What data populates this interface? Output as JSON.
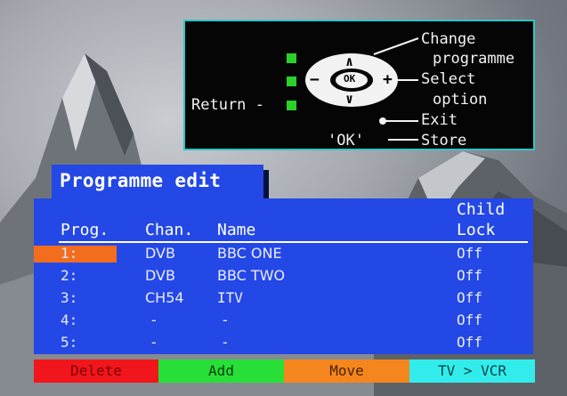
{
  "keypanel": {
    "change_line1": "Change",
    "change_line2": "programme",
    "select_line1": "Select",
    "select_line2": "option",
    "exit_label": "Exit",
    "return_label": "Return -",
    "ok_key": "OK",
    "ok_quote": "'OK'",
    "store_label": "Store",
    "up_symbol": "∧",
    "down_symbol": "∨",
    "minus_symbol": "−",
    "plus_symbol": "+",
    "accent_colors": {
      "key_green": "#2bd12b",
      "border": "#2ec7c7"
    }
  },
  "title": "Programme edit",
  "table": {
    "headers": {
      "prog": "Prog.",
      "chan": "Chan.",
      "name": "Name",
      "child_line1": "Child",
      "child_line2": "Lock"
    },
    "rows": [
      {
        "prog": "1:",
        "chan": "DVB",
        "name": "BBC ONE",
        "lock": "Off",
        "selected": true
      },
      {
        "prog": "2:",
        "chan": "DVB",
        "name": "BBC TWO",
        "lock": "Off",
        "selected": false
      },
      {
        "prog": "3:",
        "chan": "CH54",
        "name": "ITV",
        "lock": "Off",
        "selected": false
      },
      {
        "prog": "4:",
        "chan": "-",
        "name": "-",
        "lock": "Off",
        "selected": false
      },
      {
        "prog": "5:",
        "chan": "-",
        "name": "-",
        "lock": "Off",
        "selected": false
      }
    ],
    "colors": {
      "panel": "#2448e6",
      "selection": "#f26d1e"
    }
  },
  "function_bar": {
    "delete": "Delete",
    "add": "Add",
    "move": "Move",
    "tv_vcr": "TV > VCR",
    "colors": {
      "red": "#f0161b",
      "green": "#27df37",
      "orange": "#f5861e",
      "cyan": "#32ecec"
    }
  }
}
